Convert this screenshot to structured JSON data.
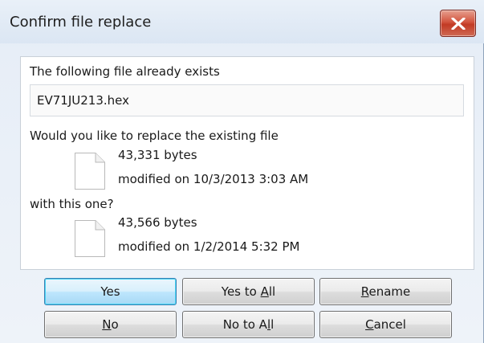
{
  "window": {
    "title": "Confirm file replace"
  },
  "panel": {
    "exists_label": "The following file already exists",
    "filename": "EV71JU213.hex",
    "question": "Would you like to replace the existing file",
    "existing_file": {
      "size": "43,331 bytes",
      "modified": "modified on 10/3/2013 3:03 AM"
    },
    "with_label": "with this one?",
    "new_file": {
      "size": "43,566 bytes",
      "modified": "modified on 1/2/2014 5:32 PM"
    }
  },
  "buttons": {
    "yes": "Yes",
    "yes_to_all_pre": "Yes to ",
    "yes_to_all_key": "A",
    "yes_to_all_post": "ll",
    "rename_key": "R",
    "rename_post": "ename",
    "no_key": "N",
    "no_post": "o",
    "no_to_all_pre": "No to A",
    "no_to_all_key": "l",
    "no_to_all_post": "l",
    "cancel_key": "C",
    "cancel_post": "ancel"
  },
  "icons": {
    "close": "close-icon",
    "file": "document-icon"
  },
  "colors": {
    "close_button": "#c8432c",
    "default_button_border": "#3c7fb1",
    "titlebar": "#dbe6f3"
  }
}
